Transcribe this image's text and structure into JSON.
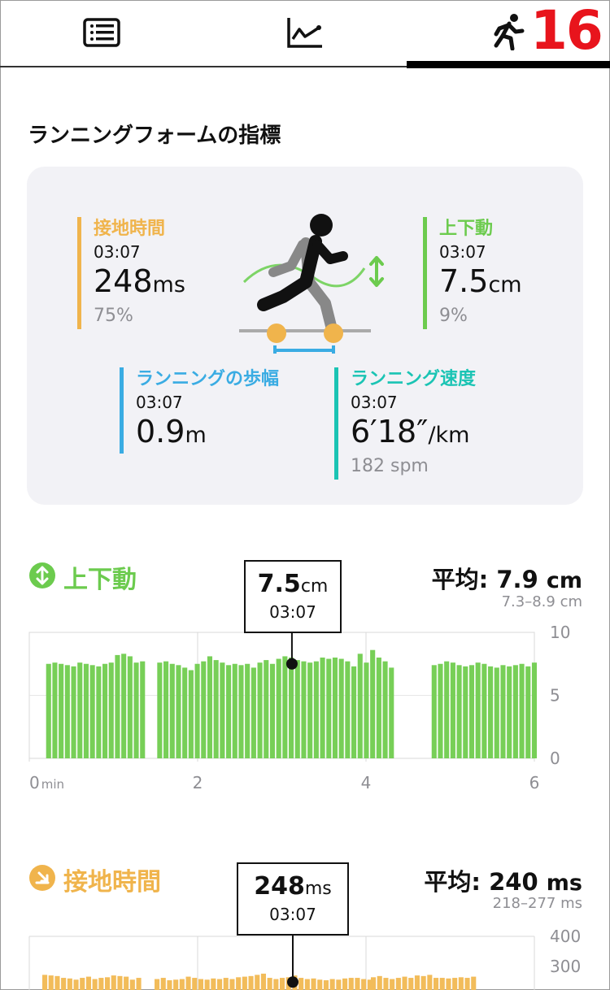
{
  "tabs": [
    {
      "icon": "list-icon"
    },
    {
      "icon": "line-chart-icon"
    },
    {
      "icon": "running-icon",
      "badge": "16",
      "active": true
    }
  ],
  "header": {
    "title": "ランニングフォームの指標"
  },
  "form_card": {
    "ground_contact": {
      "label": "接地時間",
      "time": "03:07",
      "value": "248",
      "unit": "ms",
      "sub": "75%",
      "color": "#f0b44c"
    },
    "vertical_oscillation": {
      "label": "上下動",
      "time": "03:07",
      "value": "7.5",
      "unit": "cm",
      "sub": "9%",
      "color": "#6ccb4e"
    },
    "stride_length": {
      "label": "ランニングの歩幅",
      "time": "03:07",
      "value": "0.9",
      "unit": "m",
      "color": "#3aace3"
    },
    "running_speed": {
      "label": "ランニング速度",
      "time": "03:07",
      "value": "6′18″",
      "unit": "/km",
      "sub": "182 spm",
      "color": "#1bc4b4"
    }
  },
  "vo_chart": {
    "title": "上下動",
    "avg_label": "平均:",
    "avg_value": "7.9",
    "avg_unit": "cm",
    "range": "7.3–8.9 cm",
    "tooltip_value": "7.5",
    "tooltip_unit": "cm",
    "tooltip_time": "03:07",
    "y_ticks": [
      "10",
      "5",
      "0"
    ],
    "x_ticks": [
      "0",
      "2",
      "4",
      "6"
    ],
    "x_unit": "min",
    "color": "#77cf57"
  },
  "gct_chart": {
    "title": "接地時間",
    "avg_label": "平均:",
    "avg_value": "240",
    "avg_unit": "ms",
    "range": "218–277 ms",
    "tooltip_value": "248",
    "tooltip_unit": "ms",
    "tooltip_time": "03:07",
    "y_ticks": [
      "400",
      "300"
    ],
    "color": "#f2bc5a"
  },
  "chart_data": [
    {
      "type": "bar",
      "title": "上下動",
      "ylabel": "",
      "xlabel": "min",
      "ylim": [
        0,
        10
      ],
      "xlim": [
        0,
        6
      ],
      "x_ticks": [
        0,
        2,
        4,
        6
      ],
      "segments": [
        {
          "x_start": 0.2,
          "values": [
            7.5,
            7.6,
            7.5,
            7.4,
            7.3,
            7.6,
            7.5,
            7.4,
            7.3,
            7.5,
            7.6,
            8.2,
            8.3,
            8.1,
            7.6,
            7.7
          ]
        },
        {
          "x_start": 1.52,
          "values": [
            7.6,
            7.7,
            7.5,
            7.4,
            7.2,
            7.0,
            7.5,
            7.7,
            8.1,
            7.8,
            7.6,
            7.4,
            7.5,
            7.4,
            7.5,
            7.2,
            7.6,
            7.8,
            7.5,
            7.9,
            8.1,
            8.0,
            7.8,
            7.7,
            7.6,
            7.7,
            8.0,
            7.9,
            8.0,
            7.9,
            7.7,
            7.3,
            8.3,
            7.6,
            8.6,
            8.0,
            7.7,
            7.2
          ]
        },
        {
          "x_start": 4.78,
          "values": [
            7.4,
            7.5,
            7.7,
            7.6,
            7.4,
            7.3,
            7.4,
            7.6,
            7.5,
            7.3,
            7.2,
            7.4,
            7.3,
            7.4,
            7.5,
            7.3,
            7.6
          ]
        }
      ],
      "highlight": {
        "x": 3.12,
        "value": 7.5
      }
    },
    {
      "type": "bar",
      "title": "接地時間",
      "ylim": [
        0,
        400
      ],
      "y_ticks": [
        400,
        300
      ],
      "avg": 240,
      "range": [
        218,
        277
      ],
      "highlight": {
        "x": 3.12,
        "value": 248
      }
    }
  ]
}
